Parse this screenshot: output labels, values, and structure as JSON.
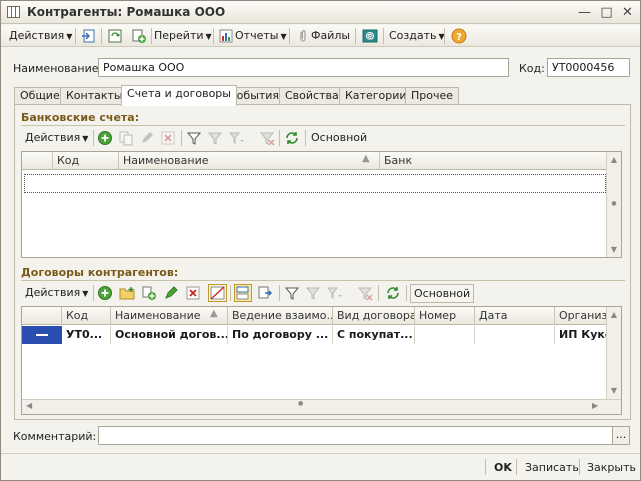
{
  "window": {
    "title": "Контрагенты: Ромашка ООО"
  },
  "toolbar": {
    "actions": "Действия",
    "goto": "Перейти",
    "reports": "Отчеты",
    "files": "Файлы",
    "create": "Создать"
  },
  "form": {
    "name_label": "Наименование:",
    "name_value": "Ромашка ООО",
    "code_label": "Код:",
    "code_value": "УТ0000456",
    "comment_label": "Комментарий:",
    "comment_value": ""
  },
  "tabs": [
    "Общие",
    "Контакты",
    "Счета и договоры",
    "События",
    "Свойства",
    "Категории",
    "Прочее"
  ],
  "bank": {
    "title": "Банковские счета:",
    "actions": "Действия",
    "main": "Основной",
    "columns": [
      "Код",
      "Наименование",
      "Банк"
    ]
  },
  "contracts": {
    "title": "Договоры контрагентов:",
    "actions": "Действия",
    "main": "Основной",
    "columns": [
      "Код",
      "Наименование",
      "Ведение взаимо...",
      "Вид договора",
      "Номер",
      "Дата",
      "Организ"
    ],
    "rows": [
      {
        "code": "УТ0...",
        "name": "Основной догов...",
        "conduct": "По договору ...",
        "kind": "С покупат...",
        "number": "",
        "date": "",
        "org": "ИП Кукс"
      }
    ]
  },
  "buttons": {
    "ok": "OK",
    "save": "Записать",
    "close": "Закрыть"
  }
}
